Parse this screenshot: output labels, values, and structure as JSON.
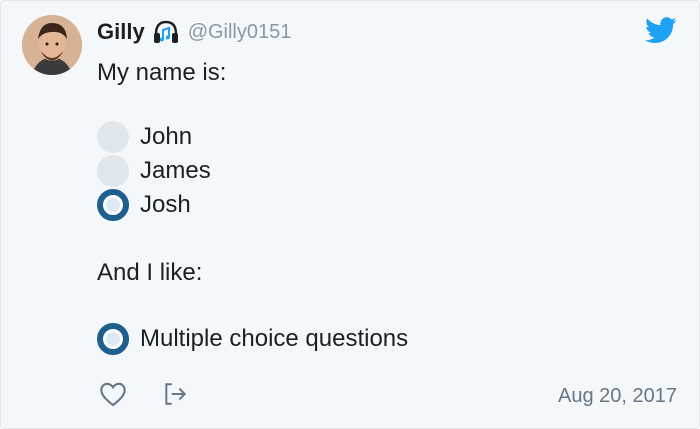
{
  "author": {
    "name": "Gilly",
    "handle": "@Gilly0151"
  },
  "icons": {
    "verified_badge": "headphones-icon",
    "platform": "twitter-bird-icon",
    "like": "heart-icon",
    "share": "share-icon"
  },
  "tweet": {
    "intro": "My name is:",
    "name_options": [
      {
        "label": "John",
        "selected": false
      },
      {
        "label": "James",
        "selected": false
      },
      {
        "label": "Josh",
        "selected": true
      }
    ],
    "like_intro": "And I like:",
    "like_options": [
      {
        "label": "Multiple choice questions",
        "selected": true
      }
    ]
  },
  "footer": {
    "date": "Aug 20, 2017"
  },
  "colors": {
    "card_bg": "#f5f8fa",
    "radio_selected": "#1f5f8d",
    "radio_unselected": "#e1e8ed",
    "twitter_blue": "#1da1f2",
    "muted": "#8899a6"
  }
}
